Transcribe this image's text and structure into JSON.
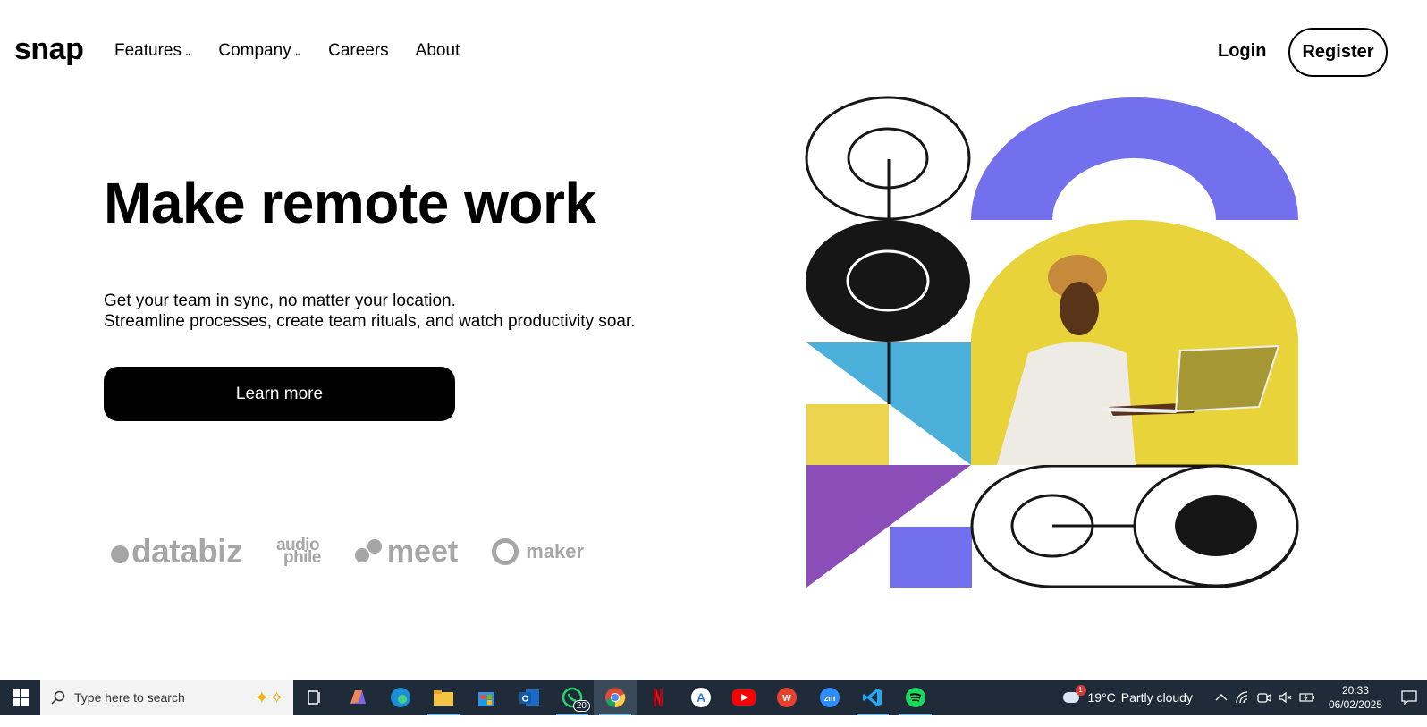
{
  "brand": {
    "logo": "snap"
  },
  "nav": {
    "items": [
      {
        "label": "Features",
        "has_dropdown": true
      },
      {
        "label": "Company",
        "has_dropdown": true
      },
      {
        "label": "Careers",
        "has_dropdown": false
      },
      {
        "label": "About",
        "has_dropdown": false
      }
    ],
    "chevron": "⌄",
    "login": "Login",
    "register": "Register"
  },
  "hero": {
    "title": "Make remote work",
    "subtitle_line1": "Get your team in sync, no matter your location.",
    "subtitle_line2": "Streamline processes, create team rituals, and watch productivity soar.",
    "cta": "Learn more"
  },
  "clients": {
    "databiz": "databiz",
    "audiophile_top": "audio",
    "audiophile_bottom": "phile",
    "meet": "meet",
    "maker": "maker"
  },
  "colors": {
    "purple": "#7370ee",
    "yellow_photo": "#e8d33a",
    "blue": "#4bafd9",
    "yellow": "#ecd44f",
    "violet": "#8b4db8",
    "dark": "#161616",
    "taskbar": "#1f2b38"
  },
  "taskbar": {
    "search_placeholder": "Type here to search",
    "apps": [
      {
        "name": "task-view-icon"
      },
      {
        "name": "copilot-icon"
      },
      {
        "name": "edge-icon"
      },
      {
        "name": "file-explorer-icon"
      },
      {
        "name": "microsoft-store-icon"
      },
      {
        "name": "outlook-icon"
      },
      {
        "name": "whatsapp-icon",
        "badge": "20"
      },
      {
        "name": "chrome-icon"
      },
      {
        "name": "netflix-icon"
      },
      {
        "name": "app-store-icon"
      },
      {
        "name": "youtube-icon"
      },
      {
        "name": "wps-office-icon"
      },
      {
        "name": "zoom-icon"
      },
      {
        "name": "vscode-icon"
      },
      {
        "name": "spotify-icon"
      }
    ],
    "whatsapp_badge": "20",
    "weather_temp": "19°C",
    "weather_desc": "Partly cloudy",
    "weather_alert": "1",
    "time": "20:33",
    "date": "06/02/2025"
  }
}
